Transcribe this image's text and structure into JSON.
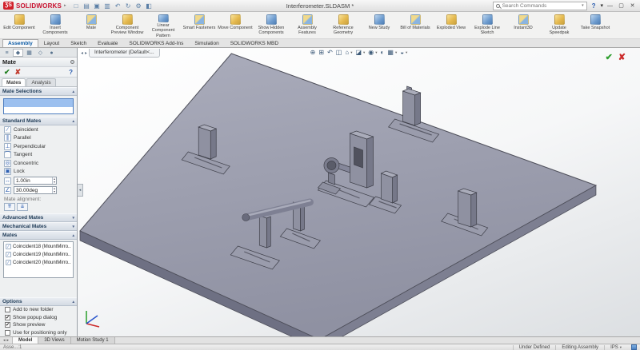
{
  "ui": {
    "chevron_up": "▴",
    "chevron_down": "▾",
    "caret": "▾",
    "nav_back": "◂",
    "nav_fwd": "▸"
  },
  "titlebar": {
    "logo_mark": "ƷS",
    "logo_text": "SOLIDWORKS",
    "quick_icons": [
      {
        "name": "new",
        "glyph": "□"
      },
      {
        "name": "open",
        "glyph": "▤"
      },
      {
        "name": "save",
        "glyph": "▣"
      },
      {
        "name": "print",
        "glyph": "▥"
      },
      {
        "name": "undo",
        "glyph": "↶"
      },
      {
        "name": "rebuild",
        "glyph": "↻"
      },
      {
        "name": "options",
        "glyph": "⚙"
      },
      {
        "name": "edit-appearance",
        "glyph": "◧"
      }
    ],
    "title": "Interferometer.SLDASM *",
    "search_placeholder": "Search Commands",
    "help": "?",
    "window": {
      "min": "—",
      "max": "▢",
      "close": "✕"
    }
  },
  "ribbon": {
    "buttons": [
      {
        "label": "Edit Component"
      },
      {
        "label": "Insert Components"
      },
      {
        "label": "Mate"
      },
      {
        "label": "Component Preview Window"
      },
      {
        "label": "Linear Component Pattern"
      },
      {
        "label": "Smart Fasteners"
      },
      {
        "label": "Move Component"
      },
      {
        "label": "Show Hidden Components"
      },
      {
        "label": "Assembly Features"
      },
      {
        "label": "Reference Geometry"
      },
      {
        "label": "New Study"
      },
      {
        "label": "Bill of Materials"
      },
      {
        "label": "Exploded View"
      },
      {
        "label": "Explode Line Sketch"
      },
      {
        "label": "Instant3D"
      },
      {
        "label": "Update Speedpak"
      },
      {
        "label": "Take Snapshot"
      }
    ],
    "tabs": [
      {
        "label": "Assembly"
      },
      {
        "label": "Layout"
      },
      {
        "label": "Sketch"
      },
      {
        "label": "Evaluate"
      },
      {
        "label": "SOLIDWORKS Add-Ins"
      },
      {
        "label": "Simulation"
      },
      {
        "label": "SOLIDWORKS MBD"
      }
    ]
  },
  "property_manager": {
    "panel_tabs": [
      {
        "name": "featuremanager",
        "glyph": "≡"
      },
      {
        "name": "propertymanager",
        "glyph": "◆"
      },
      {
        "name": "configurationmanager",
        "glyph": "▦"
      },
      {
        "name": "dimxpertmanager",
        "glyph": "◇"
      },
      {
        "name": "displaymanager",
        "glyph": "●"
      }
    ],
    "title": "Mate",
    "actions": {
      "ok": "✔",
      "cancel": "✘",
      "help": "?"
    },
    "tabs": {
      "mates": "Mates",
      "analysis": "Analysis"
    },
    "mate_selections_label": "Mate Selections",
    "standard_mates": {
      "header": "Standard Mates",
      "items": [
        {
          "label": "Coincident",
          "glyph": "∕"
        },
        {
          "label": "Parallel",
          "glyph": "∥"
        },
        {
          "label": "Perpendicular",
          "glyph": "⊥"
        },
        {
          "label": "Tangent",
          "glyph": "⌒"
        },
        {
          "label": "Concentric",
          "glyph": "◎"
        },
        {
          "label": "Lock",
          "glyph": "▣"
        }
      ],
      "distance_glyph": "↔",
      "distance_value": "1.00in",
      "angle_glyph": "∠",
      "angle_value": "30.00deg",
      "mate_alignment_label": "Mate alignment:",
      "align_buttons": [
        {
          "name": "aligned",
          "glyph": "⇈"
        },
        {
          "name": "anti-aligned",
          "glyph": "⇊"
        }
      ]
    },
    "advanced_mates_header": "Advanced Mates",
    "mechanical_mates_header": "Mechanical Mates",
    "mates_header": "Mates",
    "mates_list": [
      {
        "glyph": "∕",
        "label": "Coincident18 (MountMirro..."
      },
      {
        "glyph": "∕",
        "label": "Coincident19 (MountMirro..."
      },
      {
        "glyph": "∕",
        "label": "Coincident20 (MountMirro..."
      }
    ],
    "options": {
      "header": "Options",
      "items": [
        {
          "label": "Add to new folder",
          "mark": ""
        },
        {
          "label": "Show popup dialog",
          "mark": "✔"
        },
        {
          "label": "Show preview",
          "mark": "✔"
        },
        {
          "label": "Use for positioning only",
          "mark": ""
        }
      ]
    }
  },
  "viewport": {
    "doc_tab": "Interferometer (Default<...",
    "view_toolbar": [
      {
        "name": "zoom-fit",
        "glyph": "⊕"
      },
      {
        "name": "zoom-area",
        "glyph": "⊞"
      },
      {
        "name": "previous-view",
        "glyph": "↶"
      },
      {
        "name": "section-view",
        "glyph": "◫"
      },
      {
        "name": "view-orientation",
        "glyph": "⌂"
      },
      {
        "name": "display-style",
        "glyph": "◪"
      },
      {
        "name": "hide-show-items",
        "glyph": "◉"
      },
      {
        "name": "edit-appearance",
        "glyph": "◐"
      },
      {
        "name": "apply-scene",
        "glyph": "▦"
      },
      {
        "name": "view-settings",
        "glyph": "◒"
      }
    ],
    "confirm_ok": "✔",
    "confirm_cancel": "✘"
  },
  "model_tabs": {
    "tabs": [
      {
        "label": "Model"
      },
      {
        "label": "3D Views"
      },
      {
        "label": "Motion Study 1"
      }
    ]
  },
  "statusbar": {
    "left": "Asse...:1",
    "status": "Under Defined",
    "mode": "Editing Assembly",
    "units": "IPS"
  }
}
